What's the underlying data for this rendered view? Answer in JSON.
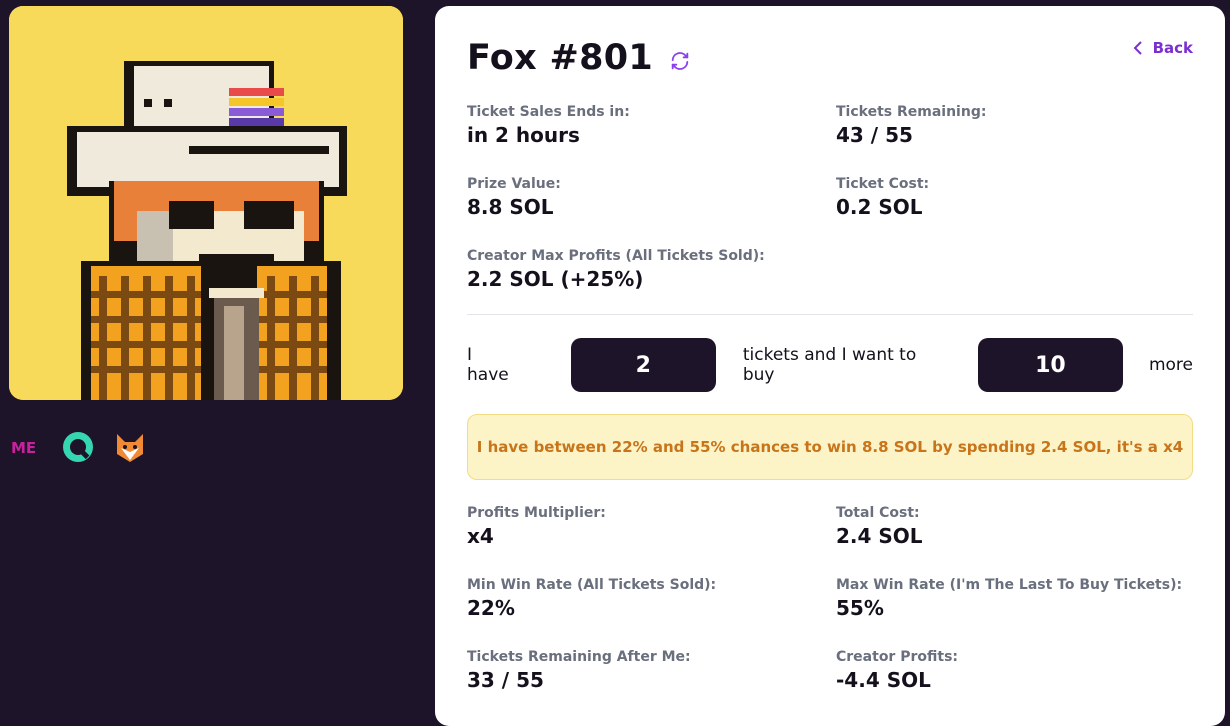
{
  "nft": {
    "name": "Fox #801",
    "image_alt": "Pixel art fox wearing a cream bucket hat and plaid jacket"
  },
  "marketplaces": [
    {
      "name": "magic-eden",
      "icon": "magic-eden-icon"
    },
    {
      "name": "explorer",
      "icon": "q-circle-icon"
    },
    {
      "name": "famous-fox",
      "icon": "fox-head-icon"
    }
  ],
  "nav": {
    "back_label": "Back"
  },
  "stats": {
    "sales_end_label": "Ticket Sales Ends in:",
    "sales_end_value": "in 2 hours",
    "tickets_remaining_label": "Tickets Remaining:",
    "tickets_remaining_value": "43 / 55",
    "prize_value_label": "Prize Value:",
    "prize_value_value": "8.8 SOL",
    "ticket_cost_label": "Ticket Cost:",
    "ticket_cost_value": "0.2 SOL",
    "creator_max_label": "Creator Max Profits (All Tickets Sold):",
    "creator_max_value": "2.2 SOL (+25%)"
  },
  "buy": {
    "text_have": "I have",
    "have_count": "2",
    "text_middle": "tickets and I want to buy",
    "want_count": "10",
    "text_more": "more"
  },
  "alert": {
    "message": "I have between 22% and 55% chances to win 8.8 SOL by spending 2.4 SOL, it's a x4"
  },
  "results": {
    "multiplier_label": "Profits Multiplier:",
    "multiplier_value": "x4",
    "total_cost_label": "Total Cost:",
    "total_cost_value": "2.4 SOL",
    "min_win_label": "Min Win Rate (All Tickets Sold):",
    "min_win_value": "22%",
    "max_win_label": "Max Win Rate (I'm The Last To Buy Tickets):",
    "max_win_value": "55%",
    "remaining_after_label": "Tickets Remaining After Me:",
    "remaining_after_value": "33 / 55",
    "creator_profits_label": "Creator Profits:",
    "creator_profits_value": "-4.4 SOL"
  },
  "colors": {
    "accent": "#7b2fd0",
    "background": "#1e1429",
    "nft_bg": "#f8da5a",
    "alert_text": "#c8741a"
  }
}
